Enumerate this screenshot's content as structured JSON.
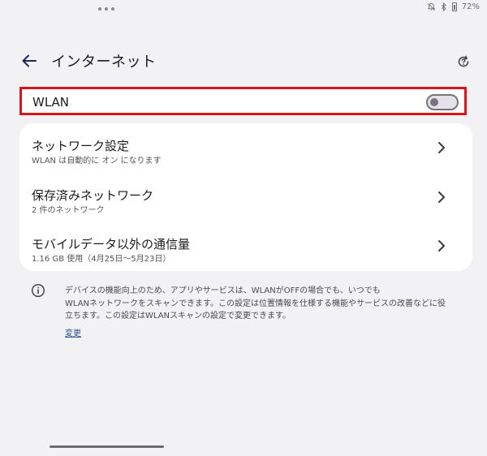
{
  "status_bar": {
    "battery_text": "72%",
    "icons": [
      "silent-bell-icon",
      "bluetooth-icon",
      "battery-icon"
    ]
  },
  "header": {
    "title": "インターネット",
    "back_icon": "arrow-back-icon",
    "help_icon": "help-refresh-icon"
  },
  "wlan": {
    "label": "WLAN",
    "toggle_on": false
  },
  "items": [
    {
      "title": "ネットワーク設定",
      "subtitle": "WLAN は自動的に オン になります"
    },
    {
      "title": "保存済みネットワーク",
      "subtitle": "2 件のネットワーク"
    },
    {
      "title": "モバイルデータ以外の通信量",
      "subtitle": "1.16 GB 使用（4月25日～5月23日）"
    }
  ],
  "info": {
    "line1": "デバイスの機能向上のため、アプリやサービスは、WLANがOFFの場合でも、いつでも",
    "line2": "WLANネットワークをスキャンできます。この設定は位置情報を仕様する機能やサービスの改善などに役",
    "line3": "立ちます。この設定はWLANスキャンの設定で変更できます。",
    "link": "変更"
  },
  "colors": {
    "highlight_border": "#d5161c",
    "link": "#2d4e93",
    "background": "#f2f2f4"
  }
}
